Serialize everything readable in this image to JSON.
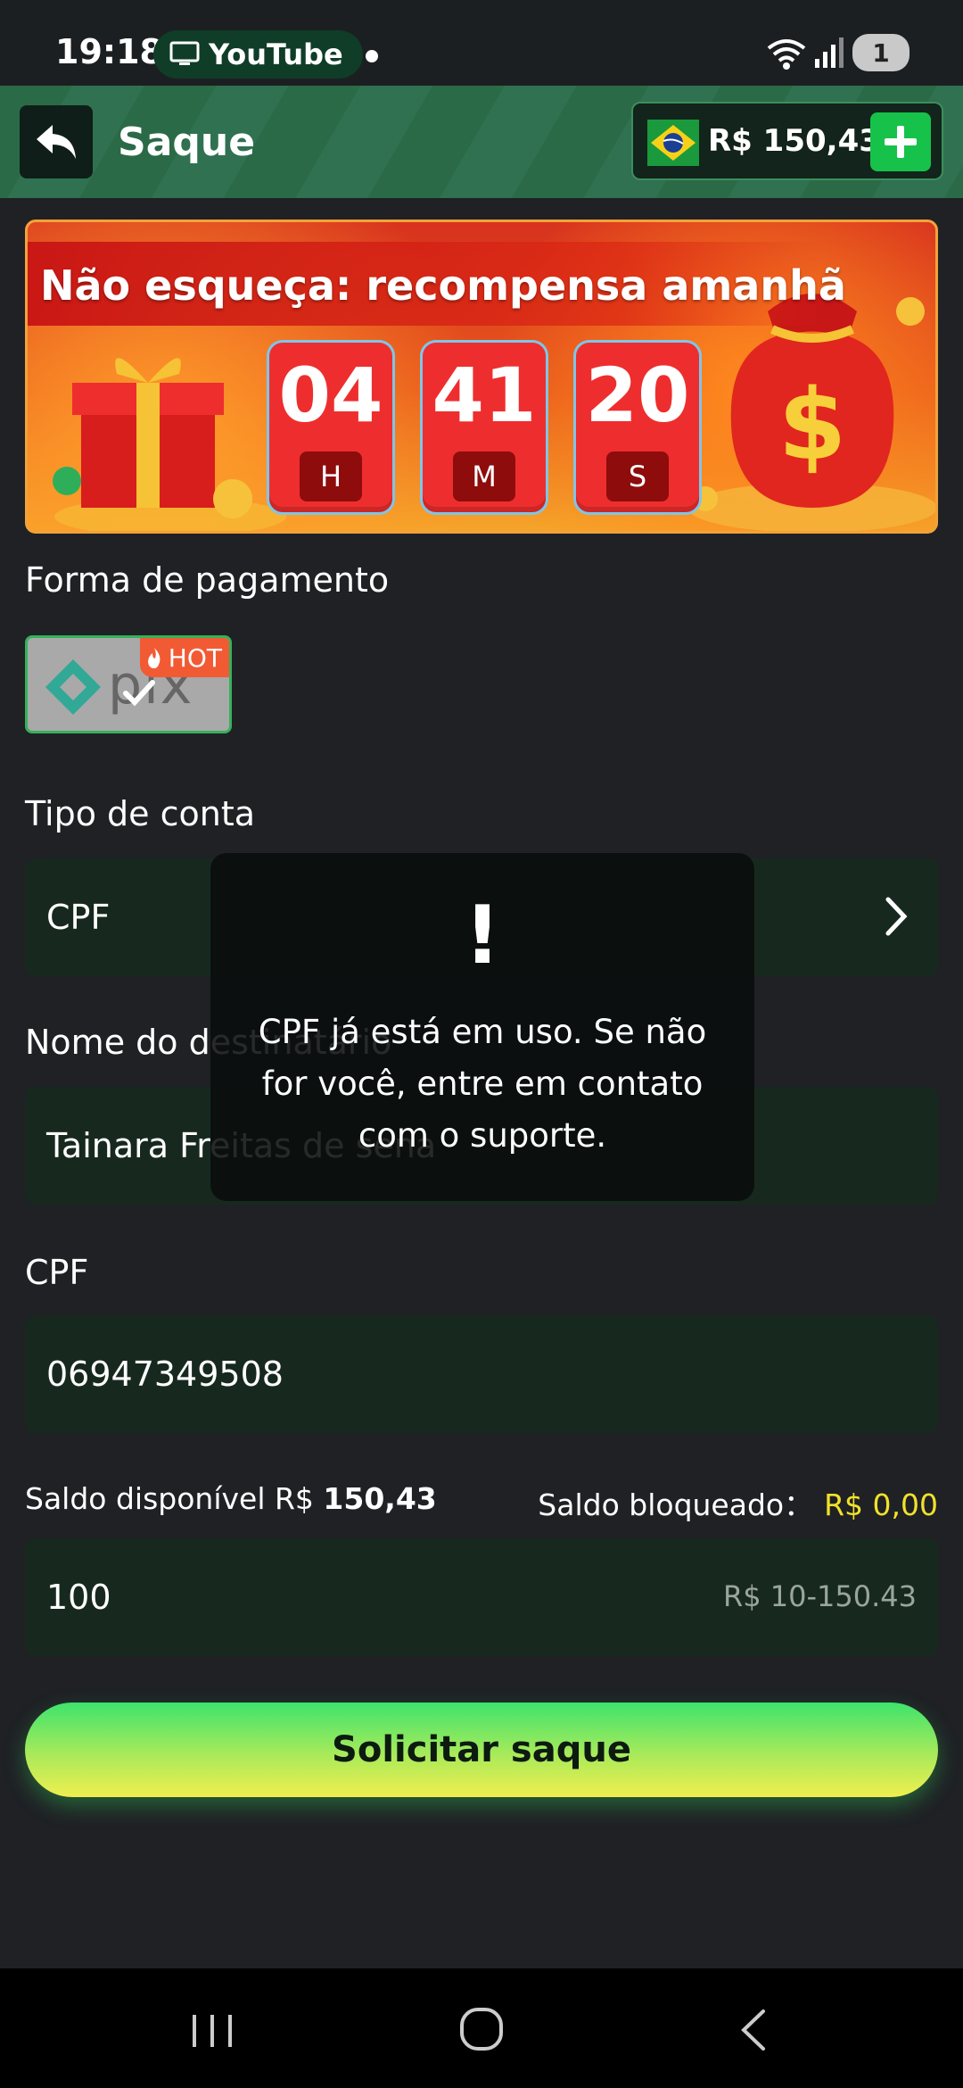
{
  "status_bar": {
    "time": "19:18",
    "app_pill": "YouTube",
    "battery": "1"
  },
  "header": {
    "title": "Saque",
    "balance": "R$ 150,43",
    "back_icon": "back-arrow-icon",
    "add_icon": "plus-icon"
  },
  "banner": {
    "title": "Não esqueça: recompensa amanhã",
    "timer": [
      {
        "value": "04",
        "unit": "H"
      },
      {
        "value": "41",
        "unit": "M"
      },
      {
        "value": "20",
        "unit": "S"
      }
    ]
  },
  "form": {
    "payment_label": "Forma de pagamento",
    "payment_option": {
      "name": "pix",
      "badge": "HOT"
    },
    "account_type_label": "Tipo de conta",
    "account_type_value": "CPF",
    "recipient_label": "Nome do destinatário",
    "recipient_value": "Tainara Freitas de sena",
    "cpf_label": "CPF",
    "cpf_value": "06947349508",
    "saldo_disponivel_label": "Saldo disponível R$",
    "saldo_disponivel_value": "150,43",
    "saldo_bloqueado_label": "Saldo bloqueado：",
    "saldo_bloqueado_value": "R$ 0,00",
    "amount_value": "100",
    "amount_range": "R$ 10-150.43",
    "submit_label": "Solicitar saque"
  },
  "toast": {
    "icon": "!",
    "message": "CPF já está em uso. Se não for você, entre em contato com o suporte."
  },
  "colors": {
    "background": "#1f2125",
    "header_green": "#2b6a47",
    "field_bg": "#17291f",
    "accent_green": "#16c24a",
    "blocked_amount": "#f2e12b"
  }
}
